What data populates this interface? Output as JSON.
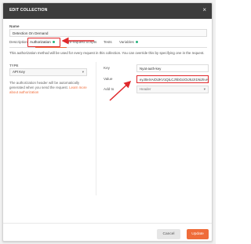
{
  "dialog": {
    "title": "EDIT COLLECTION",
    "close_glyph": "×"
  },
  "name": {
    "label": "Name",
    "value": "Detection On Demand"
  },
  "tabs": [
    {
      "label": "Description",
      "active": false,
      "dot": false
    },
    {
      "label": "Authorization",
      "active": true,
      "dot": true
    },
    {
      "label": "Pre-request Scripts",
      "active": false,
      "dot": false
    },
    {
      "label": "Tests",
      "active": false,
      "dot": false
    },
    {
      "label": "Variables",
      "active": false,
      "dot": true
    }
  ],
  "info_text": "This authorization method will be used for every request in this collection. You can override this by specifying one in the request.",
  "auth_type": {
    "label": "TYPE",
    "selected": "API Key",
    "description": "The authorization header will be automatically generated when you send the request.",
    "learn_more": "Learn more about authorization"
  },
  "fields": {
    "key_label": "Key",
    "key_value": "Nyat-auth-key",
    "value_label": "Value",
    "value_value": "eyJ0eXAiOiJKV1QiLCJhbGciOiJIUzI1NiJ9.eyJ",
    "add_to_label": "Add to",
    "add_to_value": "Header"
  },
  "footer": {
    "cancel_label": "Cancel",
    "update_label": "Update"
  },
  "colors": {
    "accent": "#ef6c3a",
    "annotation": "#e0282b",
    "titlebar": "#3c3c3c",
    "dot": "#26b47f"
  },
  "icons": {
    "close": "close-icon",
    "caret": "chevron-down-icon"
  }
}
